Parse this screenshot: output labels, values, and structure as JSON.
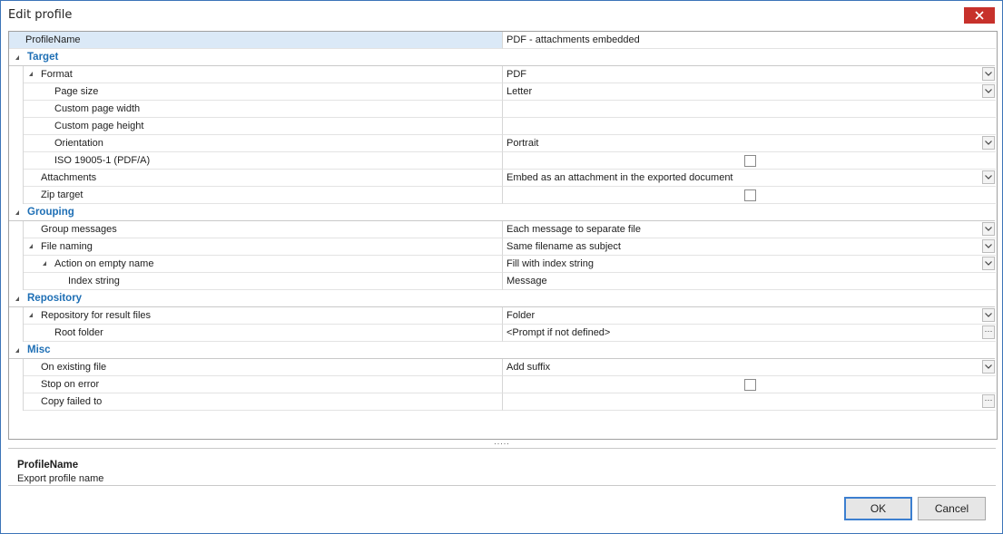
{
  "window": {
    "title": "Edit profile"
  },
  "grid": {
    "profile_name": {
      "label": "ProfileName",
      "value": "PDF - attachments embedded"
    },
    "categories": {
      "target": "Target",
      "grouping": "Grouping",
      "repository": "Repository",
      "misc": "Misc"
    },
    "rows": {
      "format": {
        "label": "Format",
        "value": "PDF"
      },
      "page_size": {
        "label": "Page size",
        "value": "Letter"
      },
      "custom_page_width": {
        "label": "Custom page width",
        "value": ""
      },
      "custom_page_height": {
        "label": "Custom page height",
        "value": ""
      },
      "orientation": {
        "label": "Orientation",
        "value": "Portrait"
      },
      "iso": {
        "label": "ISO 19005-1 (PDF/A)",
        "checked": false
      },
      "attachments": {
        "label": "Attachments",
        "value": "Embed as an attachment in the exported document"
      },
      "zip_target": {
        "label": "Zip target",
        "checked": false
      },
      "group_messages": {
        "label": "Group messages",
        "value": "Each message to separate file"
      },
      "file_naming": {
        "label": "File naming",
        "value": "Same filename as subject"
      },
      "action_on_empty_name": {
        "label": "Action on empty name",
        "value": "Fill with index string"
      },
      "index_string": {
        "label": "Index string",
        "value": "Message"
      },
      "repository_for_result_files": {
        "label": "Repository for result files",
        "value": "Folder"
      },
      "root_folder": {
        "label": "Root folder",
        "value": "<Prompt if not defined>"
      },
      "on_existing_file": {
        "label": "On existing file",
        "value": "Add suffix"
      },
      "stop_on_error": {
        "label": "Stop on error",
        "checked": false
      },
      "copy_failed_to": {
        "label": "Copy failed to",
        "value": ""
      }
    }
  },
  "splitter": {
    "glyph": "....."
  },
  "description": {
    "title": "ProfileName",
    "text": "Export profile name"
  },
  "buttons": {
    "ok": "OK",
    "cancel": "Cancel"
  },
  "colors": {
    "category_text": "#1e6fb5",
    "close_button": "#c7312b",
    "window_border": "#3c74b8"
  },
  "icons": [
    "close-icon",
    "expand-triangle-icon",
    "dropdown-arrow-icon",
    "ellipsis-icon",
    "checkbox-icon"
  ]
}
